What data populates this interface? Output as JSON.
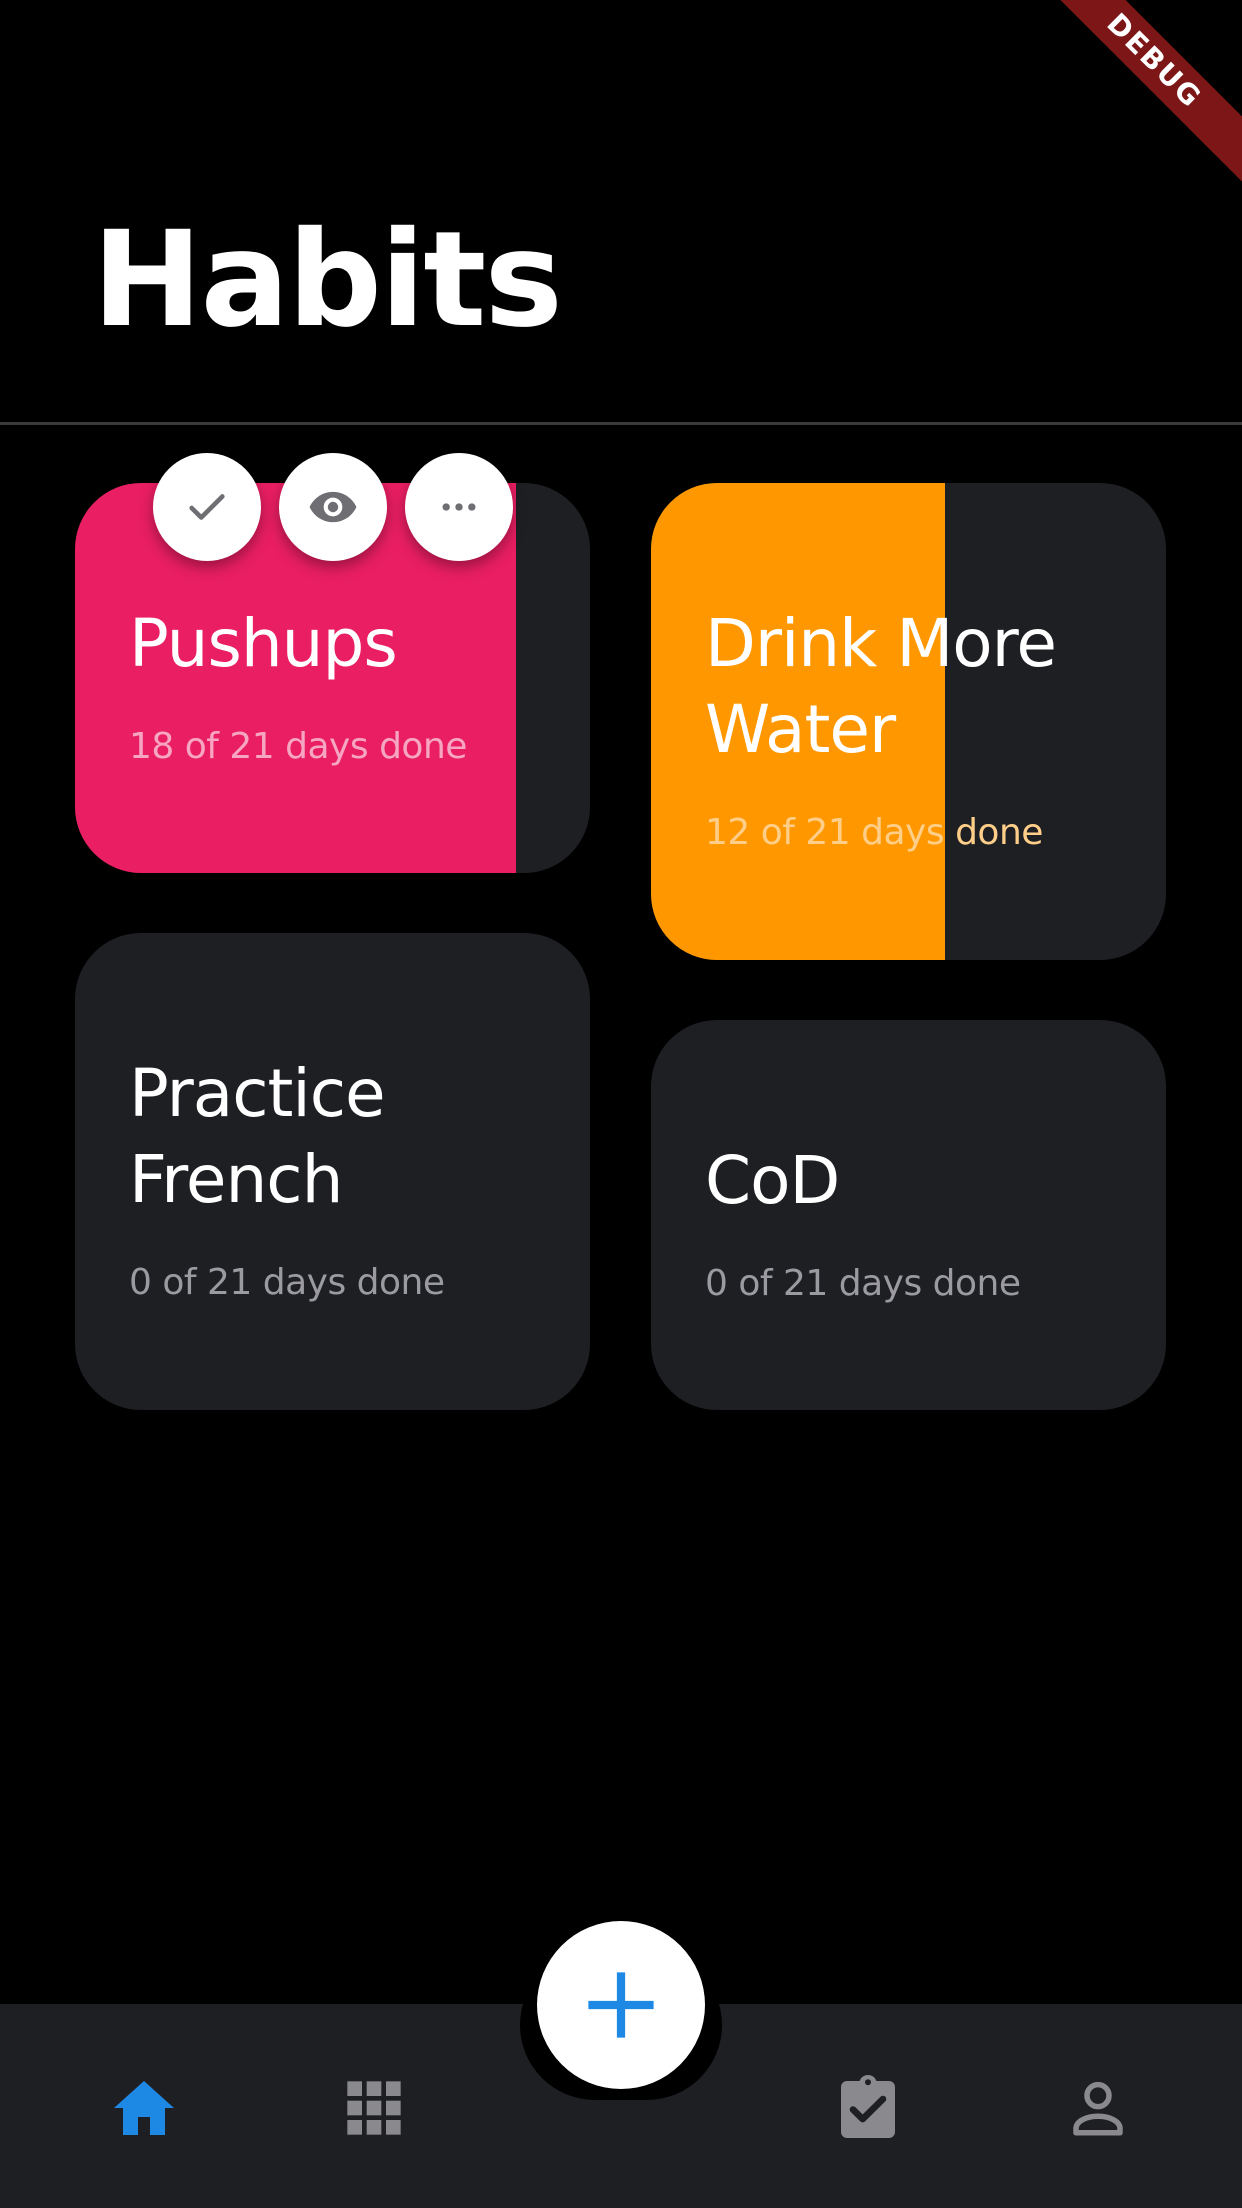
{
  "debug_banner": "DEBUG",
  "header": {
    "title": "Habits"
  },
  "colors": {
    "background": "#000000",
    "card": "#1e1f23",
    "pushups": "#e91e63",
    "water": "#ff9800",
    "accent": "#1e88e5",
    "inactive_icon": "#8a8a8e"
  },
  "card_actions": [
    {
      "icon": "check-icon"
    },
    {
      "icon": "eye-icon"
    },
    {
      "icon": "more-horizontal-icon"
    }
  ],
  "habits": [
    {
      "title": "Pushups",
      "progress": "18 of 21 days done",
      "done": 18,
      "total": 21,
      "color": "#e91e63"
    },
    {
      "title": "Drink More Water",
      "progress": "12 of 21 days done",
      "done": 12,
      "total": 21,
      "color": "#ff9800"
    },
    {
      "title": "Practice French",
      "progress": "0 of 21 days done",
      "done": 0,
      "total": 21,
      "color": ""
    },
    {
      "title": "CoD",
      "progress": "0 of 21 days done",
      "done": 0,
      "total": 21,
      "color": ""
    }
  ],
  "fab": {
    "icon": "plus-icon"
  },
  "bottom_nav": [
    {
      "icon": "home-icon",
      "active": true
    },
    {
      "icon": "grid-icon",
      "active": false
    },
    {
      "icon": "clipboard-check-icon",
      "active": false
    },
    {
      "icon": "person-icon",
      "active": false
    }
  ]
}
